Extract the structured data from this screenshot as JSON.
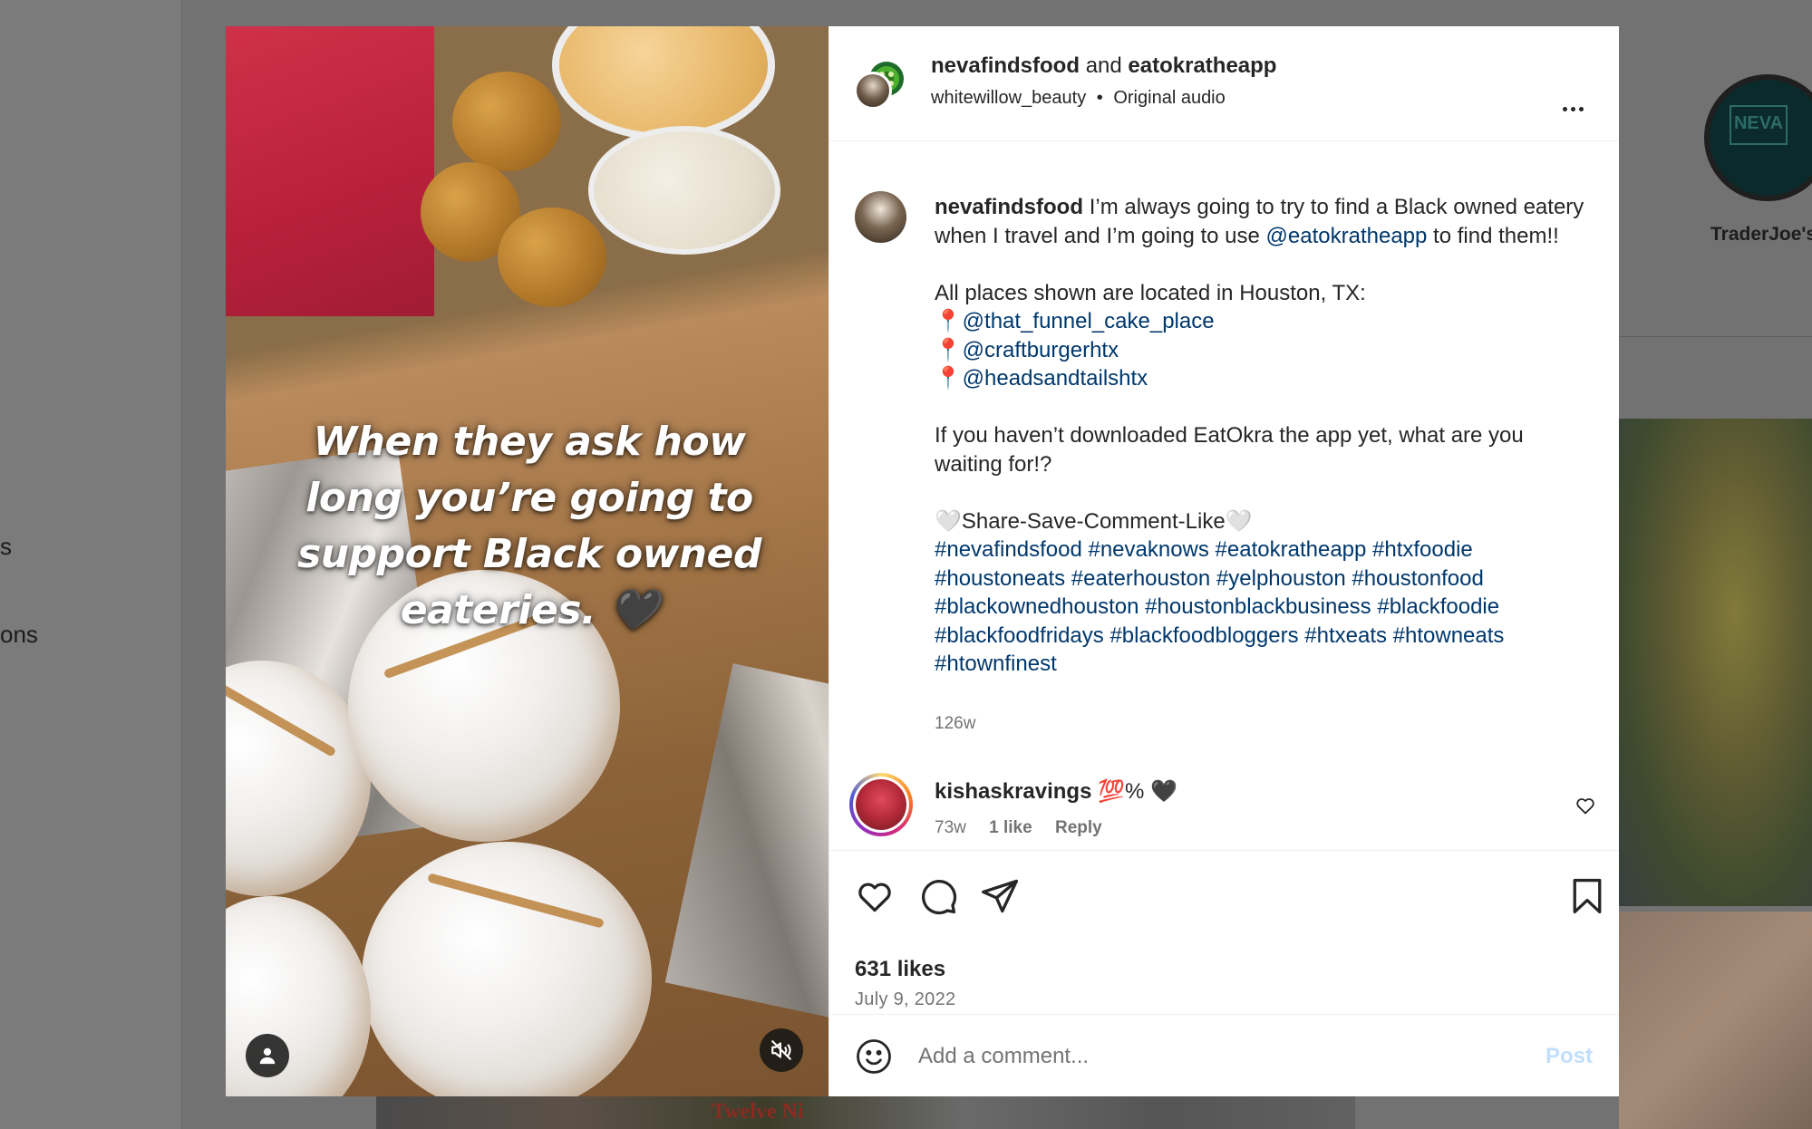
{
  "background": {
    "sidebar_fragments": [
      "s",
      "ons"
    ],
    "right_story_label": "TraderJoe's",
    "right_story_logo": "NEVA",
    "bottom_strip_text": "Twelve Ni"
  },
  "post": {
    "media": {
      "overlay_text": "When they ask how long you’re going to support Black owned eateries. 🖤",
      "tag_icon": "person-icon",
      "mute_icon": "speaker-muted-icon"
    },
    "header": {
      "author_primary": "nevafindsfood",
      "joiner": "and",
      "author_secondary": "eatokratheapp",
      "audio_user": "whitewillow_beauty",
      "audio_sep": "•",
      "audio_label": "Original audio",
      "more_icon": "more-horizontal-icon"
    },
    "caption": {
      "username": "nevafindsfood",
      "line1_pre": "I’m always going to try to find a Black owned eatery when I travel and I’m going to use",
      "line1_mention": "@eatokratheapp",
      "line1_post": "to find them!!",
      "places_intro": "All places shown are located in Houston, TX:",
      "pin_glyph": "📍",
      "places": [
        "@that_funnel_cake_place",
        "@craftburgerhtx",
        "@headsandtailshtx"
      ],
      "question": "If you haven’t downloaded EatOkra the app yet, what are you waiting for!?",
      "cta_heart": "🤍",
      "cta_text": "Share-Save-Comment-Like",
      "hashtags": "#nevafindsfood #nevaknows #eatokratheapp #htxfoodie #houstoneats #eaterhouston #yelphouston #houstonfood #blackownedhouston #houstonblackbusiness #blackfoodie #blackfoodfridays #blackfoodbloggers #htxeats #htowneats #htownfinest",
      "time": "126w"
    },
    "comment": {
      "username": "kishaskravings",
      "text": "💯% 🖤",
      "time": "73w",
      "likes": "1 like",
      "reply": "Reply"
    },
    "actions": {
      "likes": "631 likes",
      "date": "July 9, 2022"
    },
    "add_comment": {
      "placeholder": "Add a comment...",
      "post_label": "Post"
    }
  },
  "colors": {
    "link": "#00376b",
    "muted": "#737373",
    "text": "#262626",
    "post_disabled": "#c0dffd"
  }
}
